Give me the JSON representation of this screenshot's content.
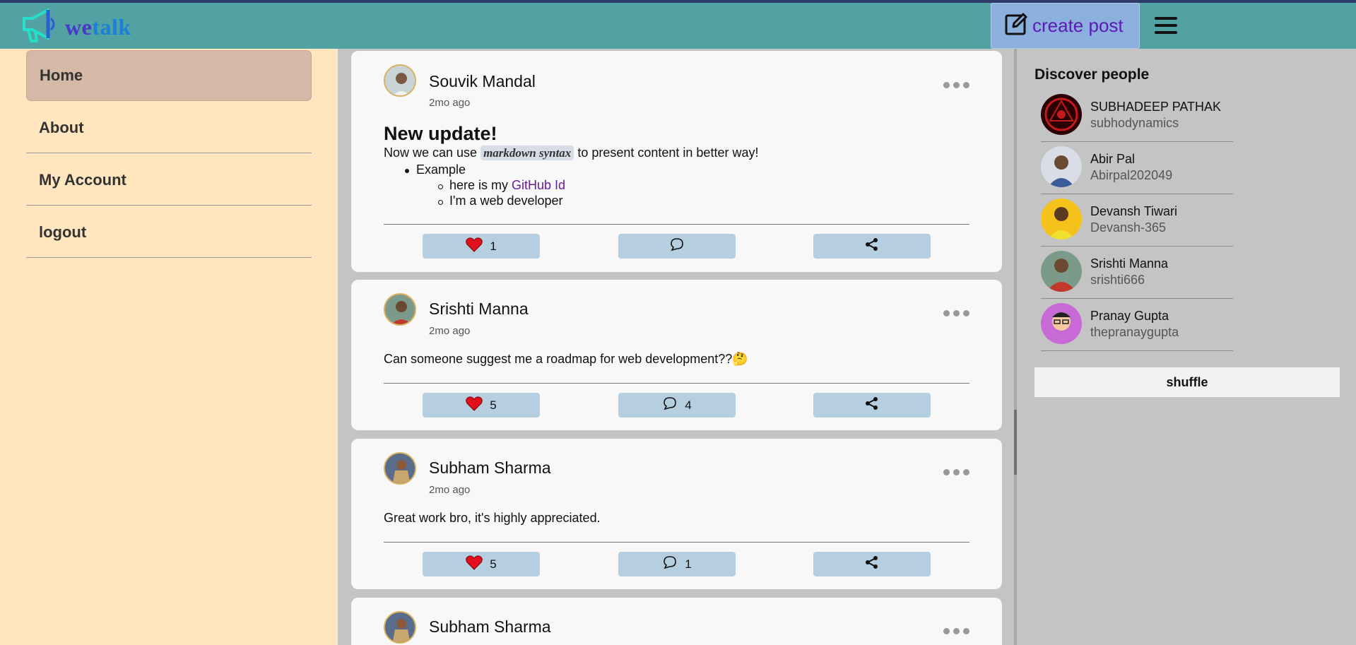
{
  "app": {
    "logo_text_main": "we",
    "logo_text_accent": "talk",
    "create_post_label": "create post"
  },
  "sidebar": {
    "items": [
      {
        "label": "Home",
        "active": true
      },
      {
        "label": "About"
      },
      {
        "label": "My Account"
      },
      {
        "label": "logout"
      }
    ]
  },
  "posts": [
    {
      "author": "Souvik Mandal",
      "time": "2mo ago",
      "title": "New update!",
      "text_before": "Now we can use ",
      "code": "markdown syntax",
      "text_after": " to present content in better way!",
      "list_item": "Example",
      "sub_item_1_prefix": "here is my ",
      "sub_item_1_link": "GitHub Id",
      "sub_item_2": "I'm a web developer",
      "likes": "1",
      "comments": ""
    },
    {
      "author": "Srishti Manna",
      "time": "2mo ago",
      "text": "Can someone suggest me a roadmap for web development??🤔",
      "likes": "5",
      "comments": "4"
    },
    {
      "author": "Subham Sharma",
      "time": "2mo ago",
      "text": "Great work bro, it's highly appreciated.",
      "likes": "5",
      "comments": "1"
    },
    {
      "author": "Subham Sharma"
    }
  ],
  "discover": {
    "title": "Discover people",
    "people": [
      {
        "name": "SUBHADEEP PATHAK",
        "username": "subhodynamics"
      },
      {
        "name": "Abir Pal",
        "username": "Abirpal202049"
      },
      {
        "name": "Devansh Tiwari",
        "username": "Devansh-365"
      },
      {
        "name": "Srishti Manna",
        "username": "srishti666"
      },
      {
        "name": "Pranay Gupta",
        "username": "thepranaygupta"
      }
    ],
    "shuffle_label": "shuffle"
  },
  "colors": {
    "header": "#52a2a3",
    "sidebar": "#ffe6bf",
    "active_nav": "#d5b8a6",
    "action_button": "#b5cfe0",
    "like_heart": "#e0101c"
  }
}
